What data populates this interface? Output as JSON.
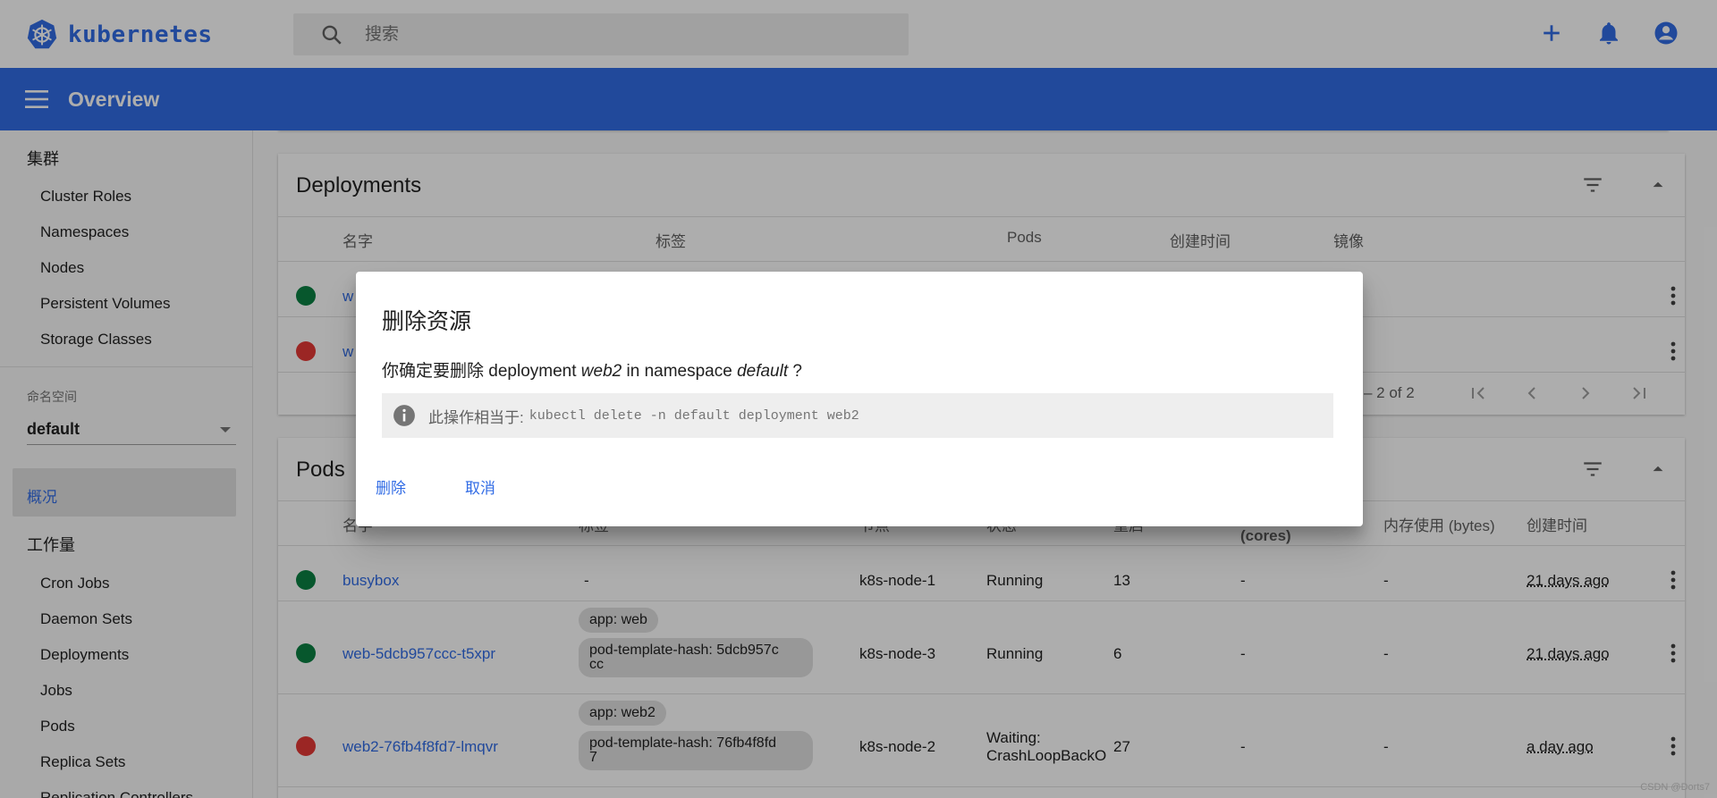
{
  "topbar": {
    "logo_text": "kubernetes",
    "search_placeholder": "搜索"
  },
  "header": {
    "title": "Overview"
  },
  "sidebar": {
    "cluster_group": "集群",
    "cluster_items": [
      "Cluster Roles",
      "Namespaces",
      "Nodes",
      "Persistent Volumes",
      "Storage Classes"
    ],
    "namespace_label": "命名空间",
    "namespace_value": "default",
    "active_item": "概况",
    "workloads_group": "工作量",
    "workload_items": [
      "Cron Jobs",
      "Daemon Sets",
      "Deployments",
      "Jobs",
      "Pods",
      "Replica Sets",
      "Replication Controllers"
    ]
  },
  "deployments": {
    "title": "Deployments",
    "columns": [
      "名字",
      "标签",
      "Pods",
      "创建时间",
      "镜像"
    ],
    "rows": [
      {
        "status": "ok",
        "name": "w"
      },
      {
        "status": "error",
        "name": "w"
      }
    ],
    "pager_text": "– 2 of 2"
  },
  "pods": {
    "title": "Pods",
    "columns": [
      "名字",
      "标签",
      "节点",
      "状态",
      "重启",
      "(cores)",
      "内存使用 (bytes)",
      "创建时间"
    ],
    "rows": [
      {
        "status": "ok",
        "name": "busybox",
        "labels": [
          "-"
        ],
        "node": "k8s-node-1",
        "state": "Running",
        "restarts": "13",
        "cpu": "-",
        "mem": "-",
        "created": "21 days ago"
      },
      {
        "status": "ok",
        "name": "web-5dcb957ccc-t5xpr",
        "labels": [
          "app: web",
          "pod-template-hash: 5dcb957c",
          "cc"
        ],
        "node": "k8s-node-3",
        "state": "Running",
        "restarts": "6",
        "cpu": "-",
        "mem": "-",
        "created": "21 days ago"
      },
      {
        "status": "error",
        "name": "web2-76fb4f8fd7-lmqvr",
        "labels": [
          "app: web2",
          "pod-template-hash: 76fb4f8fd",
          "7"
        ],
        "node": "k8s-node-2",
        "state": "Waiting:",
        "state2": "CrashLoopBackO",
        "restarts": "27",
        "cpu": "-",
        "mem": "-",
        "created": "a day ago"
      }
    ]
  },
  "dialog": {
    "title": "删除资源",
    "msg_prefix": "你确定要删除 deployment ",
    "msg_name": "web2",
    "msg_mid": "  in namespace ",
    "msg_ns": "default",
    "msg_suffix": " ?",
    "info_label": "此操作相当于:",
    "info_code": "kubectl delete -n default deployment web2",
    "delete_label": "删除",
    "cancel_label": "取消"
  },
  "watermark": "CSDN @Dorts7",
  "colors": {
    "accent": "#326ce5",
    "ok": "#0b8043",
    "error": "#e53935"
  }
}
